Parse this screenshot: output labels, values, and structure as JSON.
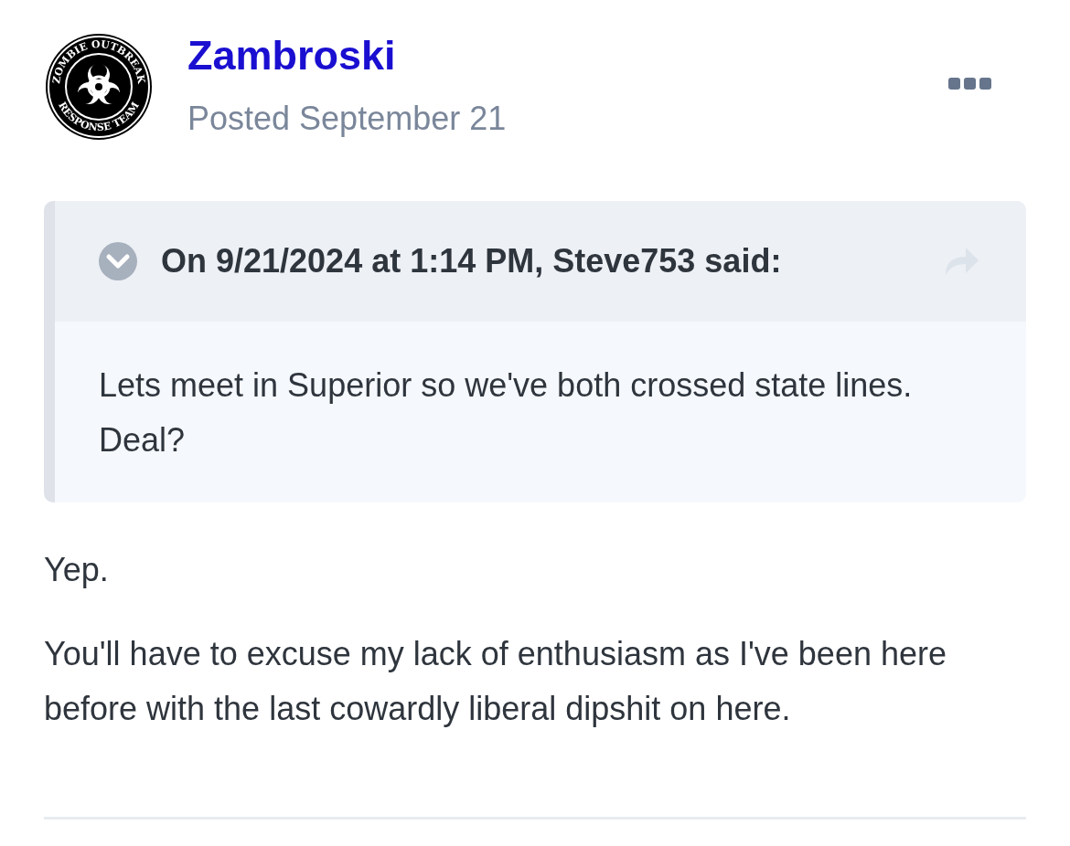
{
  "post": {
    "author": "Zambroski",
    "avatar_ring": [
      "ZOMBIE OUTBREAK",
      "RESPONSE TEAM"
    ],
    "posted": "Posted September 21",
    "quote": {
      "expanded": true,
      "header": "On 9/21/2024 at 1:14 PM, Steve753 said:",
      "text": "Lets meet in Superior so we've both crossed state lines. Deal?"
    },
    "paragraphs": [
      "Yep.",
      "You'll have to excuse my lack of enthusiasm as I've been here before with the last cowardly liberal dipshit on here."
    ]
  }
}
